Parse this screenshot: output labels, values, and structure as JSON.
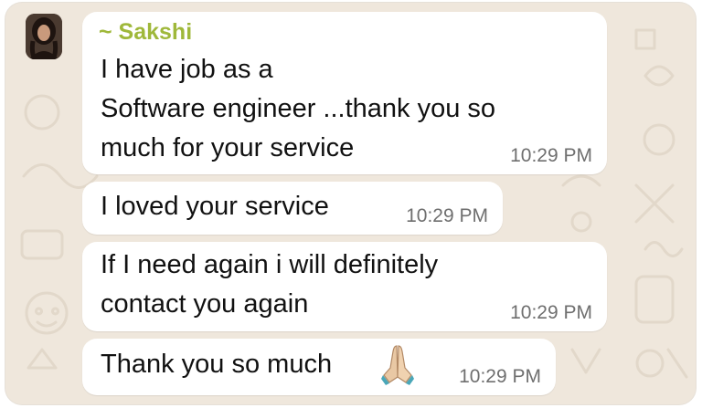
{
  "chat": {
    "sender": "~ Sakshi",
    "avatar_icon": "profile-photo",
    "messages": [
      {
        "lines": [
          "I have job as a",
          "Software engineer ...thank you so",
          "much for your service"
        ],
        "time": "10:29 PM"
      },
      {
        "lines": [
          "I loved your service"
        ],
        "time": "10:29 PM"
      },
      {
        "lines": [
          "If I need again i will definitely",
          "contact you again"
        ],
        "time": "10:29 PM"
      },
      {
        "lines": [
          "Thank you so much"
        ],
        "emoji_icon": "folded-hands-emoji",
        "time": "10:29 PM"
      }
    ]
  },
  "colors": {
    "background": "#efe7dc",
    "bubble": "#ffffff",
    "sender_name": "#9fb83a",
    "timestamp": "#6f6f6f"
  }
}
